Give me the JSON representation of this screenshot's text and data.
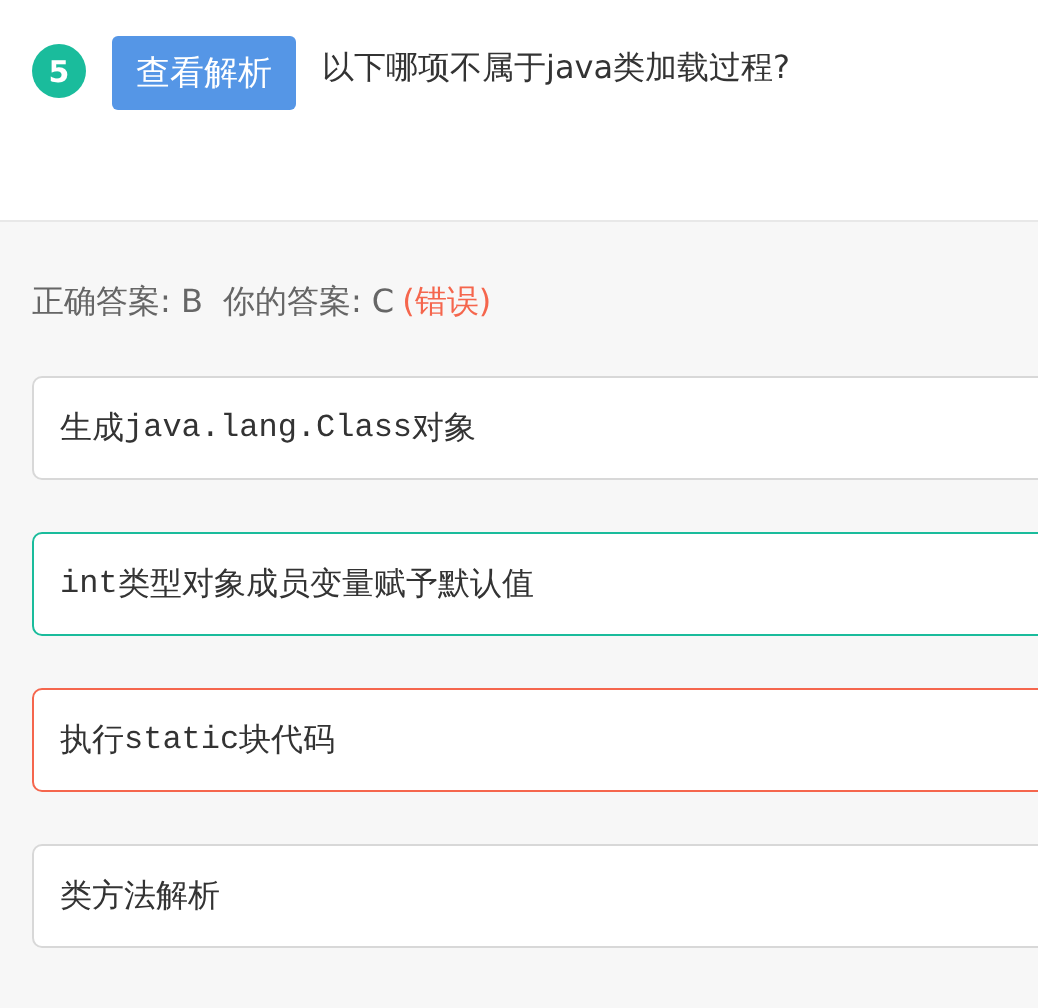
{
  "question": {
    "number": "5",
    "analysis_button": "查看解析",
    "text": "以下哪项不属于java类加载过程?"
  },
  "answer": {
    "correct_label": "正确答案: B",
    "your_label": "你的答案: C",
    "verdict": "(错误)",
    "is_correct": false
  },
  "options": [
    {
      "kind": "plain",
      "parts": [
        {
          "kind": "text",
          "text": "生成"
        },
        {
          "kind": "code",
          "text": "java.lang.Class"
        },
        {
          "kind": "text",
          "text": "对象"
        }
      ]
    },
    {
      "kind": "correct",
      "parts": [
        {
          "kind": "code",
          "text": "int"
        },
        {
          "kind": "text",
          "text": "类型对象成员变量赋予默认值"
        }
      ]
    },
    {
      "kind": "wrong",
      "parts": [
        {
          "kind": "text",
          "text": "执行"
        },
        {
          "kind": "code",
          "text": "static"
        },
        {
          "kind": "text",
          "text": "块代码"
        }
      ]
    },
    {
      "kind": "plain",
      "parts": [
        {
          "kind": "text",
          "text": "类方法解析"
        }
      ]
    }
  ]
}
